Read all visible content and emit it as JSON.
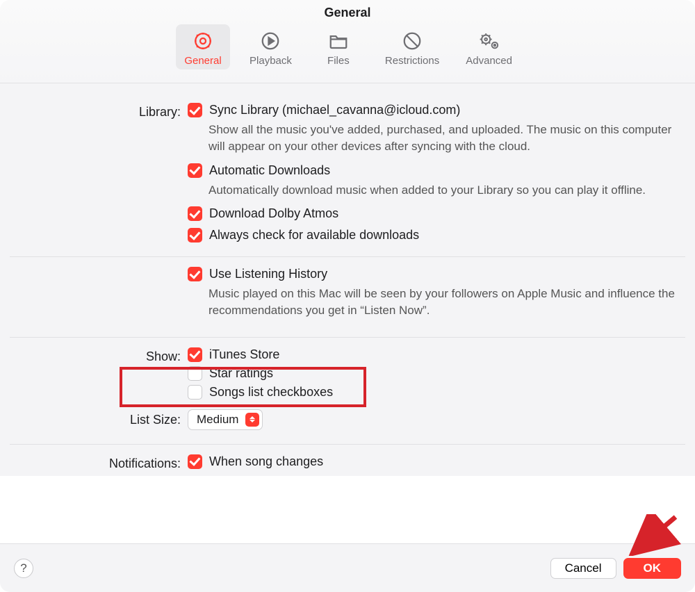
{
  "title": "General",
  "tabs": [
    {
      "id": "general",
      "label": "General",
      "active": true
    },
    {
      "id": "playback",
      "label": "Playback"
    },
    {
      "id": "files",
      "label": "Files"
    },
    {
      "id": "restrictions",
      "label": "Restrictions"
    },
    {
      "id": "advanced",
      "label": "Advanced"
    }
  ],
  "sections": {
    "library": {
      "label": "Library:",
      "sync": {
        "label": "Sync Library (michael_cavanna@icloud.com)",
        "desc": "Show all the music you've added, purchased, and uploaded. The music on this computer will appear on your other devices after syncing with the cloud."
      },
      "auto_dl": {
        "label": "Automatic Downloads",
        "desc": "Automatically download music when added to your Library so you can play it offline."
      },
      "dolby": {
        "label": "Download Dolby Atmos"
      },
      "check": {
        "label": "Always check for available downloads"
      },
      "history": {
        "label": "Use Listening History",
        "desc": "Music played on this Mac will be seen by your followers on Apple Music and influence the recommendations you get in “Listen Now”."
      }
    },
    "show": {
      "label": "Show:",
      "itunes": {
        "label": "iTunes Store"
      },
      "stars": {
        "label": "Star ratings"
      },
      "boxes": {
        "label": "Songs list checkboxes"
      }
    },
    "listsize": {
      "label": "List Size:",
      "value": "Medium"
    },
    "notifications": {
      "label": "Notifications:",
      "song": {
        "label": "When song changes"
      }
    }
  },
  "footer": {
    "cancel": "Cancel",
    "ok": "OK"
  }
}
